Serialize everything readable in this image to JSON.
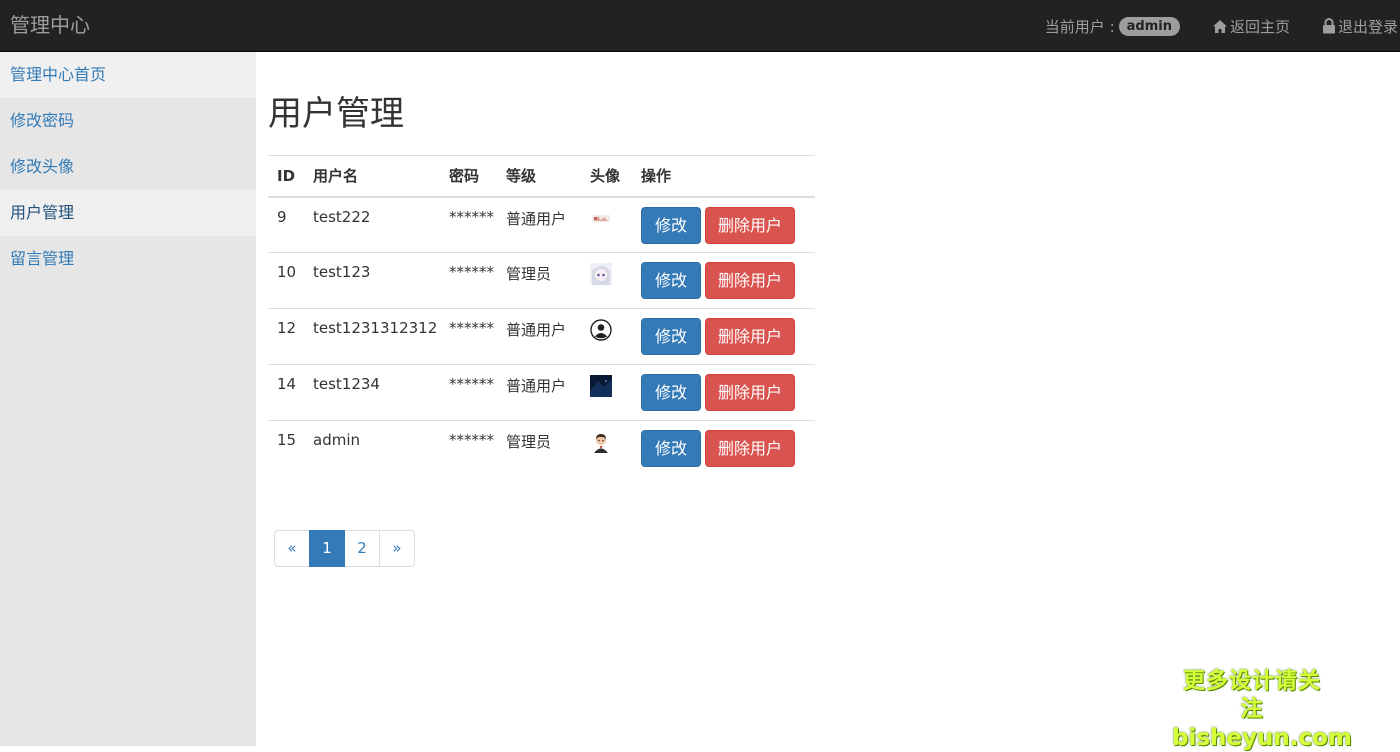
{
  "header": {
    "brand": "管理中心",
    "current_user_label": "当前用户 :",
    "current_user": "admin",
    "home_link": "返回主页",
    "logout_link": "退出登录"
  },
  "sidebar": {
    "items": [
      {
        "label": "管理中心首页"
      },
      {
        "label": "修改密码"
      },
      {
        "label": "修改头像"
      },
      {
        "label": "用户管理"
      },
      {
        "label": "留言管理"
      }
    ]
  },
  "main": {
    "title": "用户管理",
    "table": {
      "headers": [
        "ID",
        "用户名",
        "密码",
        "等级",
        "头像",
        "操作"
      ],
      "rows": [
        {
          "id": "9",
          "username": "test222",
          "password": "******",
          "level": "普通用户",
          "avatar": "drawing-avatar",
          "edit": "修改",
          "delete": "删除用户"
        },
        {
          "id": "10",
          "username": "test123",
          "password": "******",
          "level": "管理员",
          "avatar": "anime-girl-avatar",
          "edit": "修改",
          "delete": "删除用户"
        },
        {
          "id": "12",
          "username": "test1231312312",
          "password": "******",
          "level": "普通用户",
          "avatar": "default-user-avatar",
          "edit": "修改",
          "delete": "删除用户"
        },
        {
          "id": "14",
          "username": "test1234",
          "password": "******",
          "level": "普通用户",
          "avatar": "dark-image-avatar",
          "edit": "修改",
          "delete": "删除用户"
        },
        {
          "id": "15",
          "username": "admin",
          "password": "******",
          "level": "管理员",
          "avatar": "cartoon-man-avatar",
          "edit": "修改",
          "delete": "删除用户"
        }
      ]
    },
    "pagination": {
      "prev": "«",
      "pages": [
        "1",
        "2"
      ],
      "current": "1",
      "next": "»"
    }
  },
  "watermark": {
    "line1": "更多设计请关注",
    "line2": "bisheyun.com"
  },
  "colors": {
    "navbar": "#222222",
    "sidebar": "#e6e6e6",
    "primary": "#337ab7",
    "danger": "#d9534f",
    "watermark": "#d6ff3a"
  }
}
